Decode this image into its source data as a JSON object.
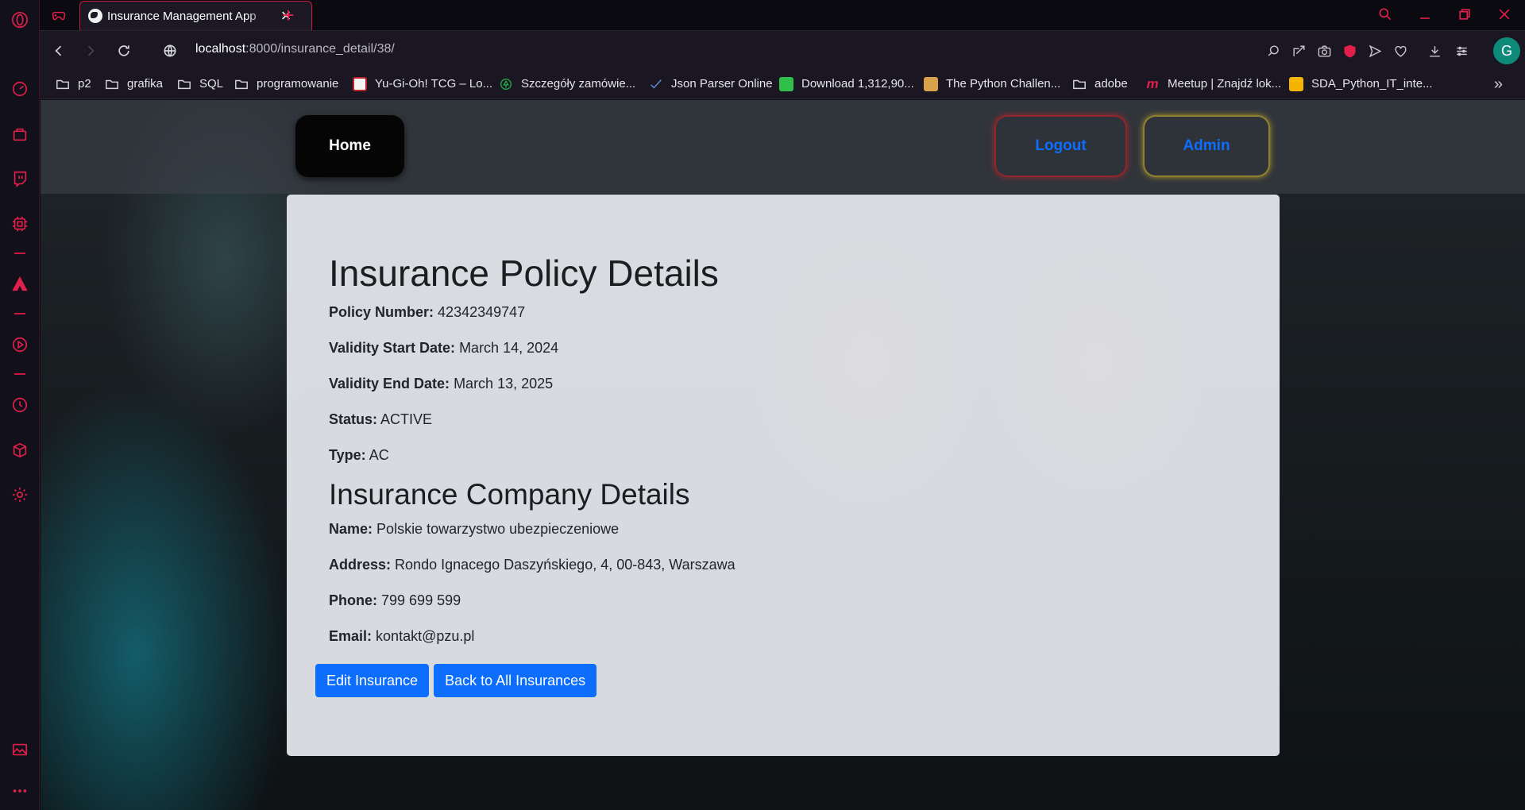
{
  "browser": {
    "tab_title": "Insurance Management App",
    "url_host": "localhost",
    "url_rest": ":8000/insurance_detail/38/",
    "avatar_letter": "G",
    "accent": "#e0204a"
  },
  "bookmarks": [
    {
      "label": "p2",
      "icon": "folder-icon"
    },
    {
      "label": "grafika",
      "icon": "folder-icon"
    },
    {
      "label": "SQL",
      "icon": "folder-icon"
    },
    {
      "label": "programowanie",
      "icon": "folder-icon"
    },
    {
      "label": "Yu-Gi-Oh! TCG – Lo...",
      "icon": "yugioh-icon"
    },
    {
      "label": "Szczegóły zamówie...",
      "icon": "tree-icon"
    },
    {
      "label": "Json Parser Online",
      "icon": "check-icon"
    },
    {
      "label": "Download 1,312,90...",
      "icon": "green-square-icon"
    },
    {
      "label": "The Python Challen...",
      "icon": "python-challenge-icon"
    },
    {
      "label": "adobe",
      "icon": "folder-icon"
    },
    {
      "label": "Meetup | Znajdź lok...",
      "icon": "meetup-icon"
    },
    {
      "label": "SDA_Python_IT_inte...",
      "icon": "slides-icon"
    }
  ],
  "nav": {
    "home": "Home",
    "logout": "Logout",
    "admin": "Admin"
  },
  "policy": {
    "title": "Insurance Policy Details",
    "number_label": "Policy Number:",
    "number": "42342349747",
    "start_label": "Validity Start Date:",
    "start": "March 14, 2024",
    "end_label": "Validity End Date:",
    "end": "March 13, 2025",
    "status_label": "Status:",
    "status": "ACTIVE",
    "type_label": "Type:",
    "type": "AC"
  },
  "company": {
    "title": "Insurance Company Details",
    "name_label": "Name:",
    "name": "Polskie towarzystwo ubezpieczeniowe",
    "address_label": "Address:",
    "address": "Rondo Ignacego Daszyńskiego, 4, 00-843, Warszawa",
    "phone_label": "Phone:",
    "phone": "799 699 599",
    "email_label": "Email:",
    "email": "kontakt@pzu.pl"
  },
  "actions": {
    "edit": "Edit Insurance",
    "back": "Back to All Insurances"
  }
}
